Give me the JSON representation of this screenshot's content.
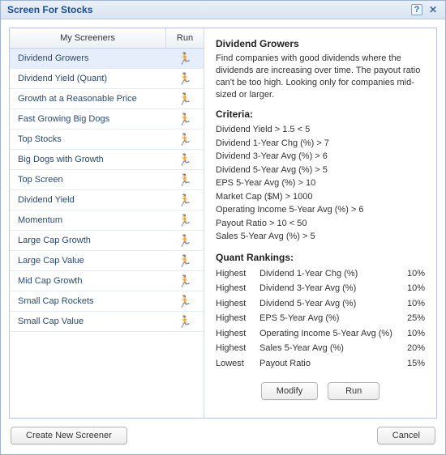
{
  "titlebar": {
    "title": "Screen For Stocks"
  },
  "list": {
    "headers": {
      "name": "My Screeners",
      "run": "Run"
    },
    "selected_index": 0,
    "items": [
      {
        "label": "Dividend Growers"
      },
      {
        "label": "Dividend Yield (Quant)"
      },
      {
        "label": "Growth at a Reasonable Price"
      },
      {
        "label": "Fast Growing Big Dogs"
      },
      {
        "label": "Top Stocks"
      },
      {
        "label": "Big Dogs with Growth"
      },
      {
        "label": "Top Screen"
      },
      {
        "label": "Dividend Yield"
      },
      {
        "label": "Momentum"
      },
      {
        "label": "Large Cap Growth"
      },
      {
        "label": "Large Cap Value"
      },
      {
        "label": "Mid Cap Growth"
      },
      {
        "label": "Small Cap Rockets"
      },
      {
        "label": "Small Cap Value"
      }
    ]
  },
  "details": {
    "title": "Dividend Growers",
    "description": "Find companies with good dividends where the dividends are increasing over time. The payout ratio can't be too high. Looking only for companies mid-sized or larger.",
    "criteria_heading": "Criteria:",
    "criteria": [
      "Dividend Yield > 1.5 < 5",
      "Dividend 1-Year Chg (%) > 7",
      "Dividend 3-Year Avg (%) > 6",
      "Dividend 5-Year Avg (%) > 5",
      "EPS 5-Year Avg (%) > 10",
      "Market Cap ($M) > 1000",
      "Operating Income 5-Year Avg (%) > 6",
      "Payout Ratio > 10 < 50",
      "Sales 5-Year Avg (%) > 5"
    ],
    "rankings_heading": "Quant Rankings:",
    "rankings": [
      {
        "dir": "Highest",
        "metric": "Dividend 1-Year Chg (%)",
        "pct": "10%"
      },
      {
        "dir": "Highest",
        "metric": "Dividend 3-Year Avg (%)",
        "pct": "10%"
      },
      {
        "dir": "Highest",
        "metric": "Dividend 5-Year Avg (%)",
        "pct": "10%"
      },
      {
        "dir": "Highest",
        "metric": "EPS 5-Year Avg (%)",
        "pct": "25%"
      },
      {
        "dir": "Highest",
        "metric": "Operating Income 5-Year Avg (%)",
        "pct": "10%"
      },
      {
        "dir": "Highest",
        "metric": "Sales 5-Year Avg (%)",
        "pct": "20%"
      },
      {
        "dir": "Lowest",
        "metric": "Payout Ratio",
        "pct": "15%"
      }
    ],
    "buttons": {
      "modify": "Modify",
      "run": "Run"
    }
  },
  "footer": {
    "create": "Create New Screener",
    "cancel": "Cancel"
  },
  "icons": {
    "runner": "🏃"
  }
}
